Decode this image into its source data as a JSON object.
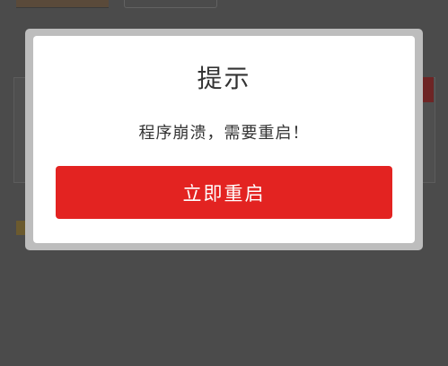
{
  "dialog": {
    "title": "提示",
    "message": "程序崩溃，需要重启！",
    "restart_button_label": "立即重启"
  },
  "colors": {
    "overlay": "#4b4b4b",
    "dialog_background": "#ffffff",
    "accent": "#e32321",
    "text": "#333333"
  }
}
